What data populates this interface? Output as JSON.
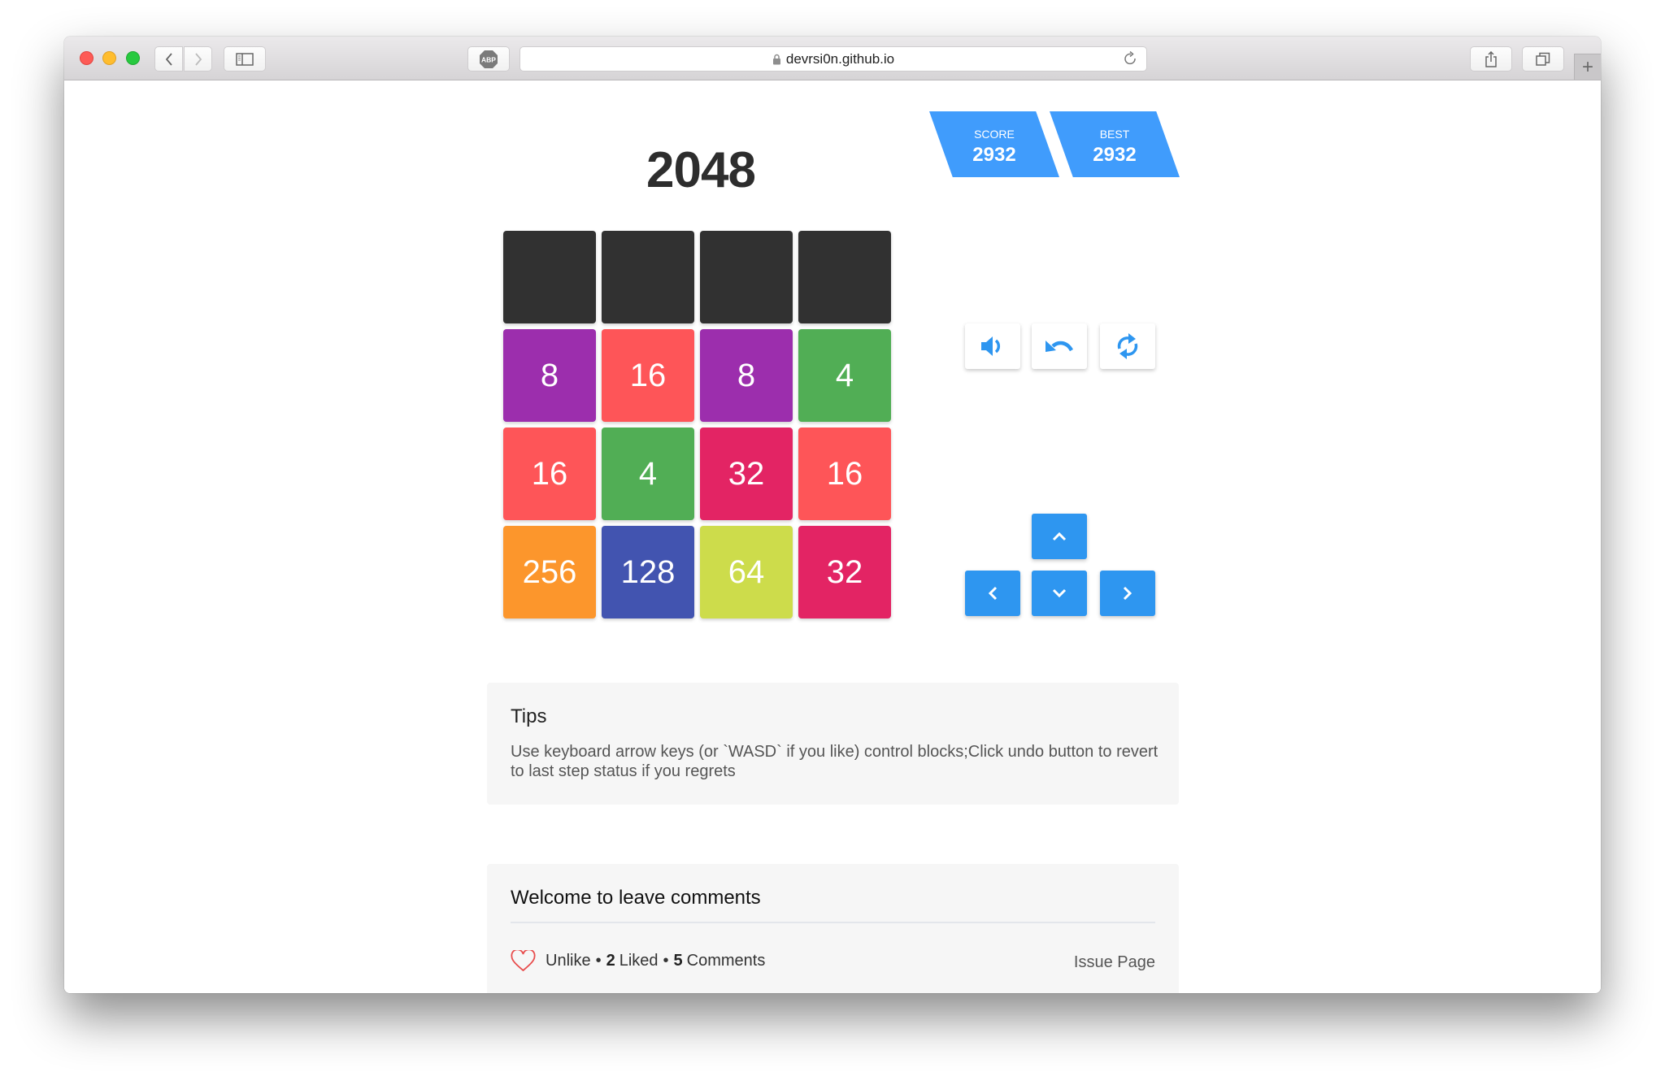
{
  "browser": {
    "url": "devrsi0n.github.io",
    "adblock_label": "ABP",
    "new_tab_label": "+"
  },
  "game": {
    "title": "2048",
    "score": {
      "label": "SCORE",
      "value": "2932"
    },
    "best": {
      "label": "BEST",
      "value": "2932"
    },
    "board": [
      [
        null,
        null,
        null,
        null
      ],
      [
        8,
        16,
        8,
        4
      ],
      [
        16,
        4,
        32,
        16
      ],
      [
        256,
        128,
        64,
        32
      ]
    ],
    "tile_colors": {
      "empty": "#313131",
      "4": "#51ae55",
      "8": "#9c2ead",
      "16": "#fe5558",
      "32": "#e32464",
      "64": "#cddc4b",
      "128": "#4254b0",
      "256": "#fc962c"
    },
    "controls": [
      {
        "name": "sound-toggle",
        "icon": "volume-icon"
      },
      {
        "name": "undo",
        "icon": "undo-icon"
      },
      {
        "name": "restart",
        "icon": "refresh-icon"
      }
    ],
    "arrows": [
      {
        "name": "up",
        "icon": "chevron-up-icon"
      },
      {
        "name": "left",
        "icon": "chevron-left-icon"
      },
      {
        "name": "down",
        "icon": "chevron-down-icon"
      },
      {
        "name": "right",
        "icon": "chevron-right-icon"
      }
    ],
    "accent_color": "#2e96f0"
  },
  "tips": {
    "title": "Tips",
    "text": "Use keyboard arrow keys (or `WASD` if you like) control blocks;Click undo button to revert to last step status if you regrets"
  },
  "comments": {
    "title": "Welcome to leave comments",
    "like_label": "Unlike",
    "sep": "•",
    "liked_count": "2",
    "liked_label": "Liked",
    "comments_count": "5",
    "comments_label": "Comments",
    "issue_page_label": "Issue Page"
  }
}
